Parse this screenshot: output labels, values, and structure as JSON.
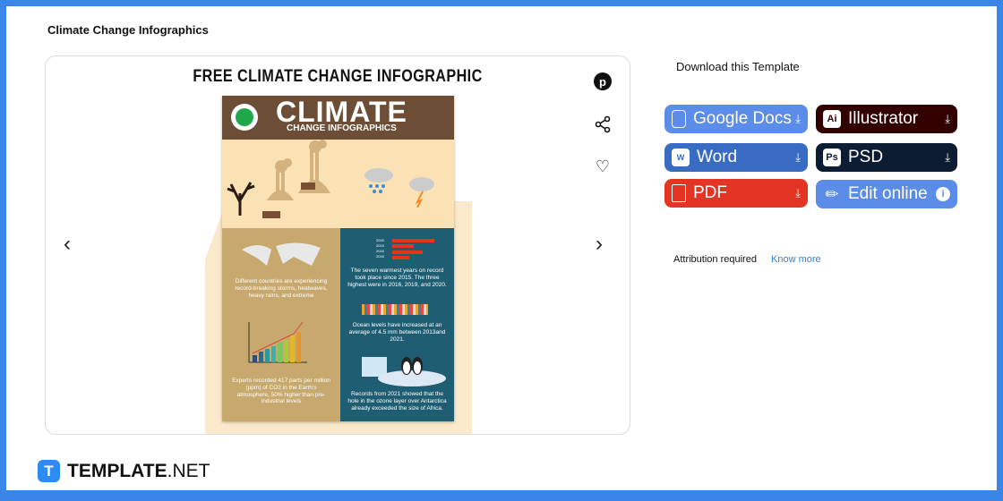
{
  "page": {
    "title": "Climate Change Infographics"
  },
  "preview": {
    "heading": "FREE CLIMATE CHANGE INFOGRAPHIC",
    "poster": {
      "title": "CLIMATE",
      "subtitle": "CHANGE INFOGRAPHICS",
      "years": [
        "2020",
        "2019",
        "2016",
        "2016"
      ],
      "text_countries": "Different countries are experiencing record-breaking storms, heatwaves, heavy rains, and extreme",
      "text_warmest": "The seven warmest years on record took place since 2015. The three highest were in 2016, 2019, and 2020.",
      "text_ocean": "Ocean levels have increased at an average of 4.5 mm between 2013and 2021.",
      "text_co2": "Experts recorded 417 parts per million (ppm) of CO2 in the Earth's atmosphere, 50% higher than pre-industrial levels",
      "text_ozone": "Records from 2021 showed that the hole in the ozone layer over Antarctica already exceeded the size of Africa."
    }
  },
  "actions": {
    "pinterest": "pinterest-icon",
    "share": "share-icon",
    "favorite": "heart-icon"
  },
  "download": {
    "title": "Download this Template",
    "buttons": [
      {
        "label": "Google Docs",
        "color": "#5a8ce8"
      },
      {
        "label": "Illustrator",
        "color": "#330000",
        "badge": "Ai"
      },
      {
        "label": "Word",
        "color": "#3a6bc3"
      },
      {
        "label": "PSD",
        "color": "#0c1d33",
        "badge": "Ps"
      },
      {
        "label": "PDF",
        "color": "#e33424"
      },
      {
        "label": "Edit online",
        "color": "#5a8ce8"
      }
    ],
    "attribution": "Attribution required",
    "know_more": "Know more"
  },
  "brand": {
    "logo_letter": "T",
    "name": "TEMPLATE",
    "suffix": ".NET"
  }
}
